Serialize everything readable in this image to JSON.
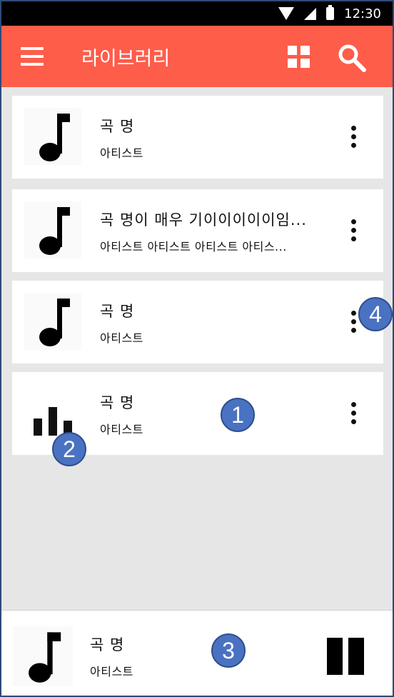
{
  "status_bar": {
    "time": "12:30"
  },
  "app_bar": {
    "title": "라이브러리",
    "icons": [
      "hamburger-icon",
      "grid-icon",
      "search-icon"
    ]
  },
  "songs": [
    {
      "title": "곡 명",
      "artist": "아티스트",
      "icon": "music-note-icon"
    },
    {
      "title": "곡 명이 매우 기이이이이이임...",
      "artist": "아티스트 아티스트 아티스트 아티스...",
      "icon": "music-note-icon"
    },
    {
      "title": "곡 명",
      "artist": "아티스트",
      "icon": "music-note-icon"
    },
    {
      "title": "곡 명",
      "artist": "아티스트",
      "icon": "equalizer-icon"
    }
  ],
  "player": {
    "title": "곡 명",
    "artist": "아티스트",
    "icon": "pause-icon"
  },
  "annotations": {
    "a1": "1",
    "a2": "2",
    "a3": "3",
    "a4": "4"
  },
  "colors": {
    "accent": "#fe5d4a",
    "background": "#e6e6e6",
    "badge": "#4a72c2"
  }
}
